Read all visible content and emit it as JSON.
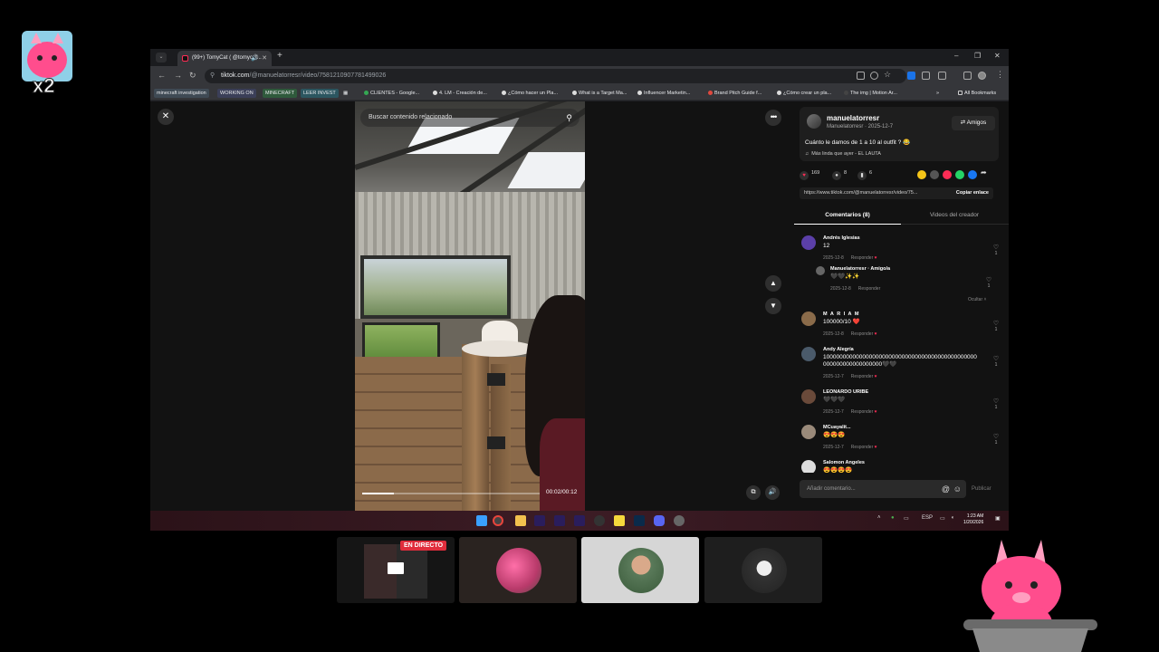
{
  "overlay": {
    "logo_text": "x2"
  },
  "browser": {
    "tab_title": "(99+) TomyCat ( @tomycat...",
    "url_host": "tiktok.com",
    "url_path": "/@manuelatorresr/video/7581210907781499026",
    "bookmarks": [
      "minecraft investigation",
      "WORKING ON",
      "MINECRAFT",
      "LEER INVEST",
      "CLIENTES - Google...",
      "4. LM - Creación de...",
      "¿Cómo hacer un Pla...",
      "What is a Target Ma...",
      "Influencer Marketin...",
      "Brand Pitch Guide f...",
      "¿Cómo crear un pla...",
      "The img | Motion Ar..."
    ],
    "all_bookmarks": "All Bookmarks"
  },
  "video": {
    "search_placeholder": "Buscar contenido relacionado",
    "time": "00:02/00:12",
    "progress": 0.18
  },
  "post": {
    "username": "manuelatorresr",
    "sub": "Manuelatorresr · 2025-12-7",
    "friends_button": "Amigos",
    "caption": "Cuánto le damos de 1 a 10 al outfit ? 😂",
    "music": "Más linda que ayer - EL LAUTA",
    "likes": "169",
    "comments_count": "8",
    "saves": "6",
    "link": "https://www.tiktok.com/@manuelatorresr/video/75...",
    "copy_label": "Copiar enlace",
    "tab_comments": "Comentarios (8)",
    "tab_creator": "Videos del creador"
  },
  "comments": [
    {
      "name": "Andrés Iglesias",
      "text": "12",
      "date": "2025-12-8",
      "reply": "Responder",
      "likes": "1",
      "color": "#5b3fa8"
    },
    {
      "name": "Manuelatorresr · Amigo/a",
      "text": "🖤🖤✨✨",
      "date": "2025-12-8",
      "reply": "Responder",
      "likes": "1",
      "color": "#666"
    },
    {
      "name": "M A R I A M",
      "text": "100000/10 ❤️",
      "date": "2025-12-8",
      "reply": "Responder",
      "likes": "1",
      "color": "#8a6b4a"
    },
    {
      "name": "Andy Alegría",
      "text": "10000000000000000000000000000000000000000000000000000000000000000🖤🖤",
      "date": "2025-12-7",
      "reply": "Responder",
      "likes": "1",
      "color": "#4a5a6a"
    },
    {
      "name": "LEONARDO URIBE",
      "text": "🖤🖤🖤",
      "date": "2025-12-7",
      "reply": "Responder",
      "likes": "1",
      "color": "#6a4a3a"
    },
    {
      "name": "MCuayalit...",
      "text": "😍😍😍",
      "date": "2025-12-7",
      "reply": "Responder",
      "likes": "1",
      "color": "#9a8a7a"
    },
    {
      "name": "Salomon Angeles",
      "text": "😍😍😍😍",
      "date": "",
      "reply": "",
      "likes": "",
      "color": "#ddd"
    }
  ],
  "hide_label": "Ocultar ˄",
  "add_comment_placeholder": "Añadir comentario...",
  "publish_label": "Publicar",
  "taskbar": {
    "lang": "ESP",
    "time": "1:23 AM",
    "date": "1/20/2026"
  },
  "tiles": {
    "live_label": "EN DIRECTO"
  }
}
